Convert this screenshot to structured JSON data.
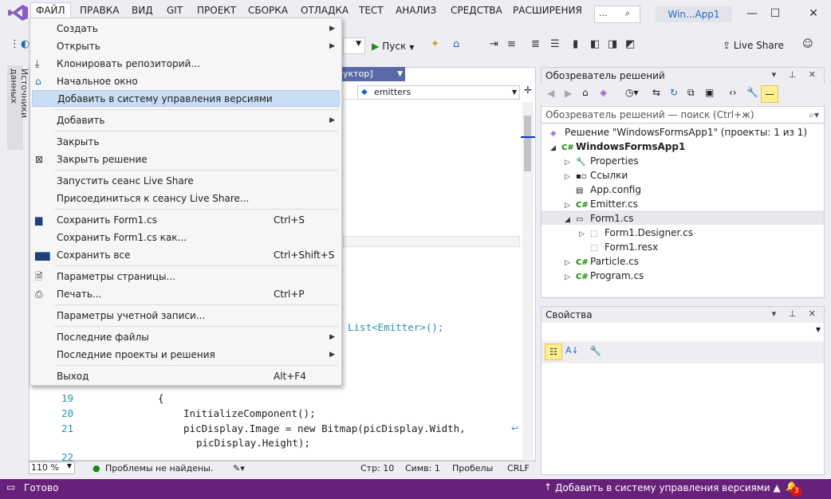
{
  "menubar": {
    "items": [
      "ФАЙЛ",
      "ПРАВКА",
      "ВИД",
      "GIT",
      "ПРОЕКТ",
      "СБОРКА",
      "ОТЛАДКА",
      "ТЕСТ",
      "АНАЛИЗ",
      "СРЕДСТВА",
      "РАСШИРЕНИЯ"
    ],
    "search": "...",
    "window_title": "Win...App1"
  },
  "toolbar": {
    "run_label": "Пуск",
    "live_share": "Live Share"
  },
  "left_tab": "Источники данных",
  "editor": {
    "doc_tab": "руктор]",
    "member_combo": "emitters",
    "partial_code": "List<Emitter>();",
    "lines": [
      {
        "n": "19",
        "code": "{"
      },
      {
        "n": "20",
        "code": "InitializeComponent();"
      },
      {
        "n": "21",
        "code": "picDisplay.Image = new Bitmap(picDisplay.Width,"
      },
      {
        "n": "",
        "code": "picDisplay.Height);"
      },
      {
        "n": "22",
        "code": ""
      }
    ],
    "status": {
      "zoom": "110 %",
      "problems": "Проблемы не найдены.",
      "line": "Стр: 10",
      "col": "Симв: 1",
      "ws": "Пробелы",
      "eol": "CRLF"
    }
  },
  "file_menu": {
    "items": [
      {
        "label": "Создать",
        "submenu": true
      },
      {
        "label": "Открыть",
        "submenu": true
      },
      {
        "label": "Клонировать репозиторий..."
      },
      {
        "label": "Начальное окно"
      },
      {
        "label": "Добавить в систему управления версиями",
        "highlighted": true
      },
      {
        "label": "Добавить",
        "submenu": true
      },
      {
        "label": "Закрыть"
      },
      {
        "label": "Закрыть решение"
      },
      {
        "label": "Запустить сеанс Live Share"
      },
      {
        "label": "Присоединиться к сеансу Live Share..."
      },
      {
        "label": "Сохранить Form1.cs",
        "shortcut": "Ctrl+S"
      },
      {
        "label": "Сохранить Form1.cs как..."
      },
      {
        "label": "Сохранить все",
        "shortcut": "Ctrl+Shift+S"
      },
      {
        "label": "Параметры страницы..."
      },
      {
        "label": "Печать...",
        "shortcut": "Ctrl+P"
      },
      {
        "label": "Параметры учетной записи..."
      },
      {
        "label": "Последние файлы",
        "submenu": true
      },
      {
        "label": "Последние проекты и решения",
        "submenu": true
      },
      {
        "label": "Выход",
        "shortcut": "Alt+F4"
      }
    ]
  },
  "solution_explorer": {
    "title": "Обозреватель решений",
    "search_placeholder": "Обозреватель решений — поиск (Ctrl+ж)",
    "tree": [
      {
        "label": "Решение \"WindowsFormsApp1\" (проекты: 1 из 1)"
      },
      {
        "label": "WindowsFormsApp1"
      },
      {
        "label": "Properties"
      },
      {
        "label": "Ссылки"
      },
      {
        "label": "App.config"
      },
      {
        "label": "Emitter.cs"
      },
      {
        "label": "Form1.cs"
      },
      {
        "label": "Form1.Designer.cs"
      },
      {
        "label": "Form1.resx"
      },
      {
        "label": "Particle.cs"
      },
      {
        "label": "Program.cs"
      }
    ]
  },
  "properties": {
    "title": "Свойства"
  },
  "statusbar": {
    "ready": "Готово",
    "vcs": "Добавить в систему управления версиями",
    "notifications": "3"
  },
  "colors": {
    "accent": "#68217a",
    "menu_highlight": "#c9def5",
    "keyword": "#0000ff",
    "type": "#2b91af"
  }
}
